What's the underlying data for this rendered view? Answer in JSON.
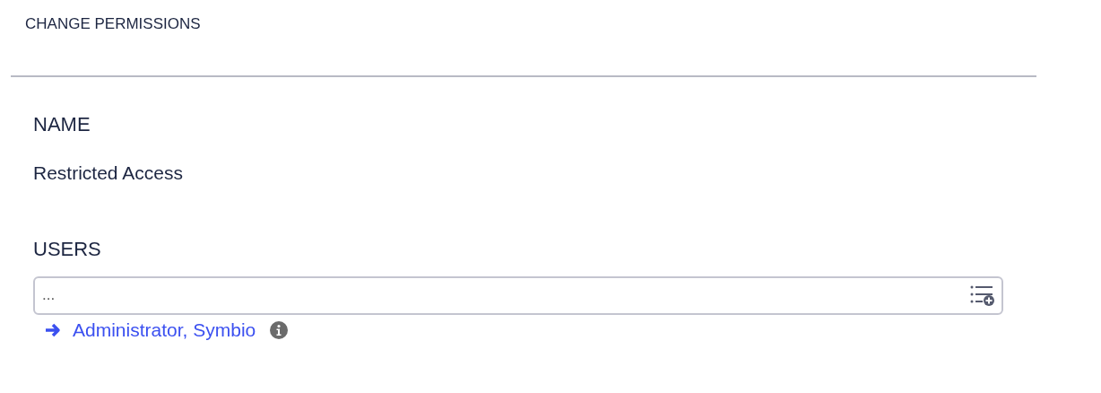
{
  "title": "CHANGE PERMISSIONS",
  "name": {
    "label": "NAME",
    "value": "Restricted Access"
  },
  "users": {
    "label": "USERS",
    "placeholder": "...",
    "items": [
      {
        "name": "Administrator, Symbio"
      }
    ]
  }
}
